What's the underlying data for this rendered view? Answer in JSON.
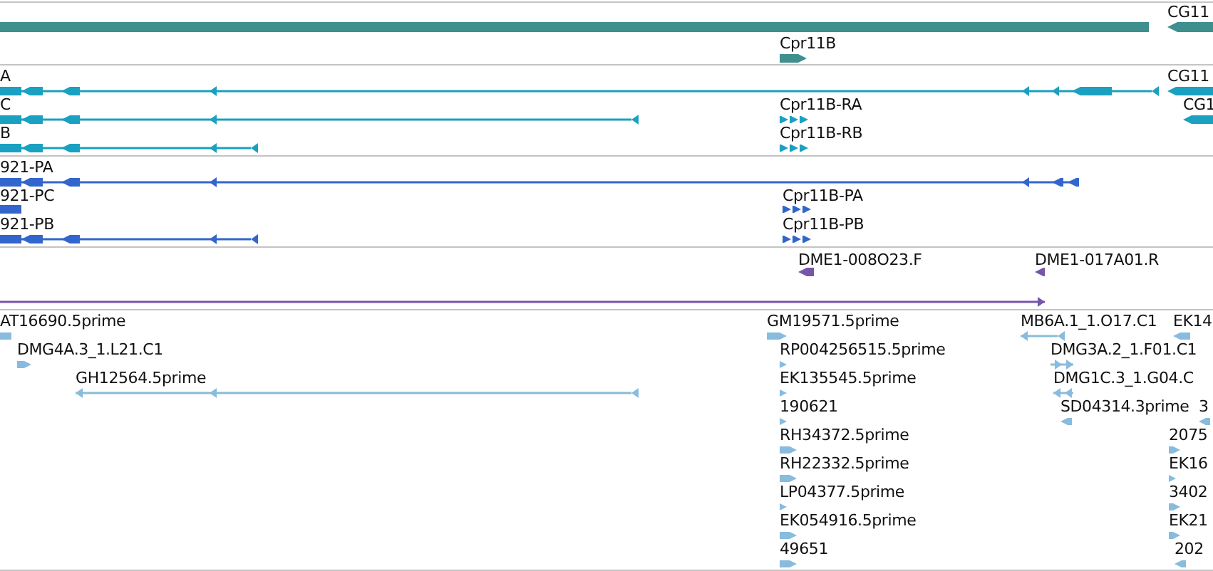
{
  "tracks": [
    {
      "color": "#3f8f8f",
      "features": [
        {
          "kind": "plain"
        },
        {
          "label": "CG11",
          "kind": "reverse"
        },
        {
          "label": "Cpr11B",
          "kind": "forward"
        }
      ]
    },
    {
      "color": "#1aa0c0",
      "features": [
        {
          "label": "A",
          "kind": "reverse"
        },
        {
          "label": "CG11",
          "kind": "reverse"
        },
        {
          "label": "C",
          "kind": "reverse"
        },
        {
          "label": "Cpr11B-RA",
          "kind": "forward"
        },
        {
          "label": "CG1",
          "kind": "reverse"
        },
        {
          "label": "B",
          "kind": "reverse"
        },
        {
          "label": "Cpr11B-RB",
          "kind": "forward"
        }
      ]
    },
    {
      "color": "#3366cc",
      "features": [
        {
          "label": "921-PA",
          "kind": "reverse"
        },
        {
          "label": "921-PC",
          "kind": "plain"
        },
        {
          "label": "Cpr11B-PA",
          "kind": "forward"
        },
        {
          "label": "921-PB",
          "kind": "reverse"
        },
        {
          "label": "Cpr11B-PB",
          "kind": "forward"
        }
      ]
    },
    {
      "color": "#7755aa",
      "features": [
        {
          "label": "DME1-008O23.F",
          "kind": "reverse"
        },
        {
          "label": "DME1-017A01.R",
          "kind": "reverse"
        },
        {
          "kind": "forward"
        }
      ]
    },
    {
      "color": "#88bbdd",
      "features": [
        {
          "label": "AT16690.5prime",
          "kind": "reverse"
        },
        {
          "label": "DMG4A.3_1.L21.C1",
          "kind": "forward"
        },
        {
          "label": "GH12564.5prime",
          "kind": "reverse"
        },
        {
          "label": "GM19571.5prime",
          "kind": "forward"
        },
        {
          "label": "RP004256515.5prime",
          "kind": "forward"
        },
        {
          "label": "EK135545.5prime",
          "kind": "forward"
        },
        {
          "label": "190621",
          "kind": "forward"
        },
        {
          "label": "RH34372.5prime",
          "kind": "forward"
        },
        {
          "label": "RH22332.5prime",
          "kind": "forward"
        },
        {
          "label": "LP04377.5prime",
          "kind": "forward"
        },
        {
          "label": "EK054916.5prime",
          "kind": "forward"
        },
        {
          "label": "49651",
          "kind": "forward"
        },
        {
          "label": "MB6A.1_1.O17.C1",
          "kind": "reverse"
        },
        {
          "label": "EK14",
          "kind": "reverse"
        },
        {
          "label": "DMG3A.2_1.F01.C1",
          "kind": "forward"
        },
        {
          "label": "DMG1C.3_1.G04.C",
          "kind": "reverse"
        },
        {
          "label": "SD04314.3prime",
          "kind": "reverse"
        },
        {
          "label": "3",
          "kind": "reverse"
        },
        {
          "label": "2075",
          "kind": "forward"
        },
        {
          "label": "EK16",
          "kind": "forward"
        },
        {
          "label": "3402",
          "kind": "forward"
        },
        {
          "label": "EK21",
          "kind": "forward"
        },
        {
          "label": "202",
          "kind": "reverse"
        }
      ]
    }
  ]
}
